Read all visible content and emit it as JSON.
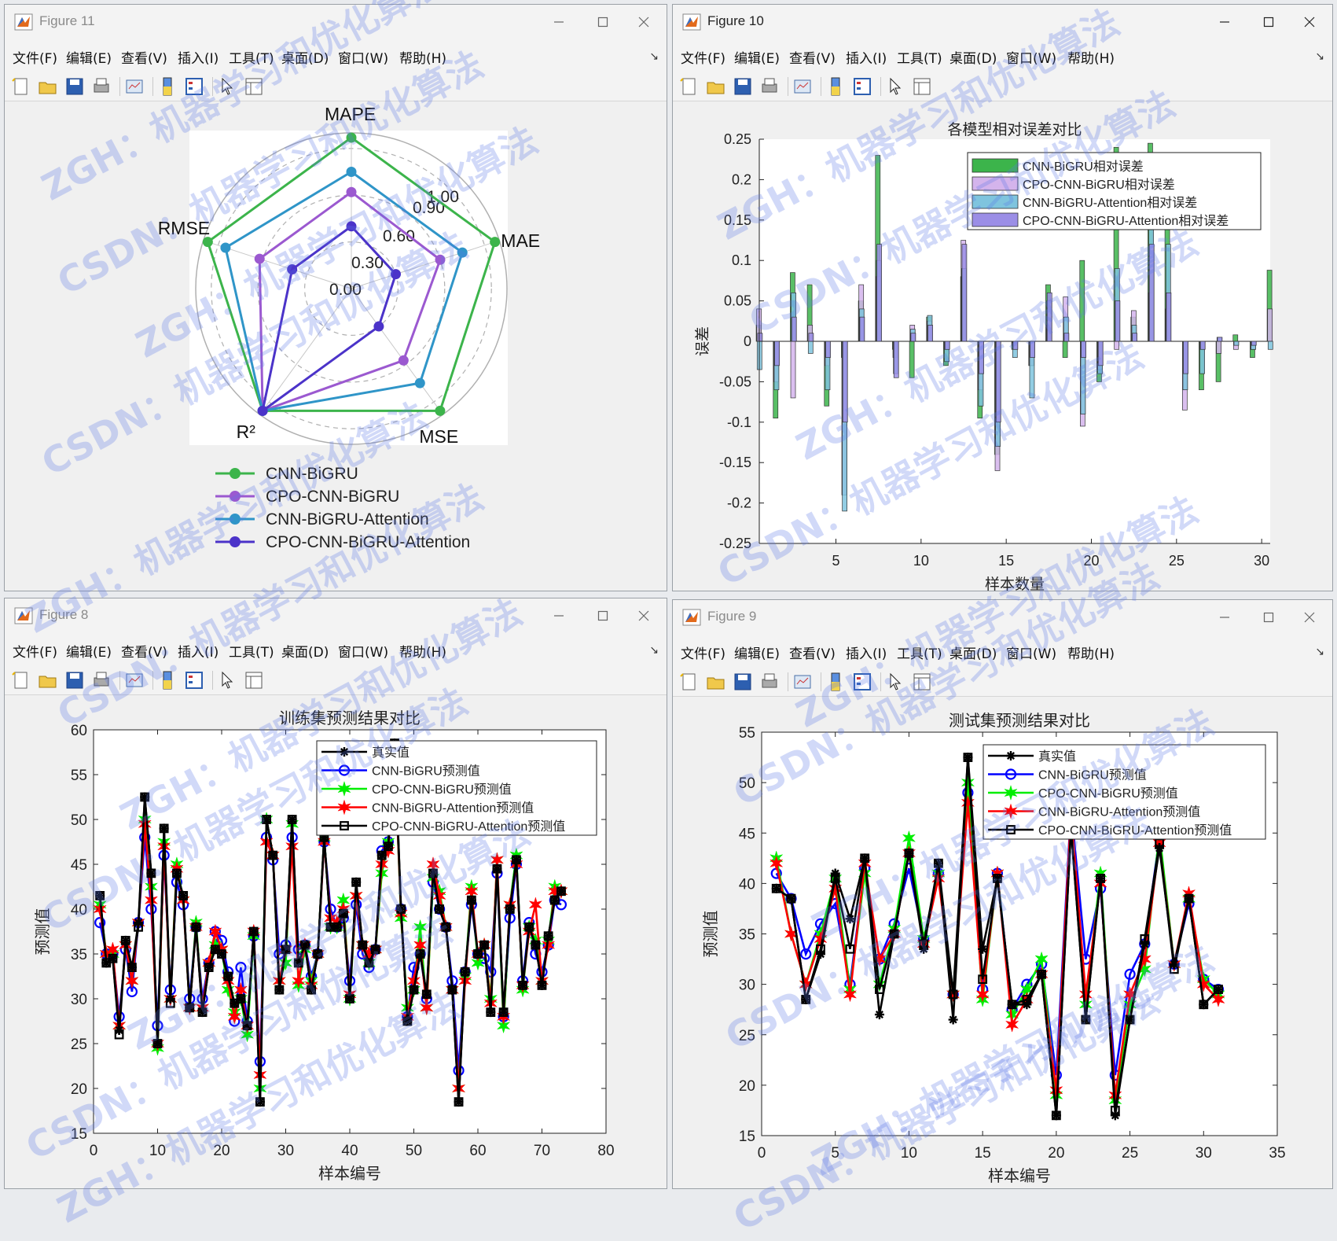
{
  "menu": [
    "文件(F)",
    "编辑(E)",
    "查看(V)",
    "插入(I)",
    "工具(T)",
    "桌面(D)",
    "窗口(W)",
    "帮助(H)"
  ],
  "windows": {
    "fig11": {
      "title": "Figure 11",
      "active": false
    },
    "fig10": {
      "title": "Figure 10",
      "active": true
    },
    "fig8": {
      "title": "Figure 8",
      "active": false
    },
    "fig9": {
      "title": "Figure 9",
      "active": false
    }
  },
  "watermark": [
    "ZGH：机器学习和优化算法",
    "CSDN：机器学习和优化算法"
  ],
  "colors": {
    "green": "#3cb44b",
    "purple": "#9b59d0",
    "blue": "#2f95c8",
    "indigo": "#4b33c9"
  },
  "chart_data": [
    {
      "type": "radar",
      "window": "fig11",
      "axes": [
        "MAPE",
        "MAE",
        "MSE",
        "R²",
        "RMSE"
      ],
      "rings": [
        0.0,
        0.3,
        0.6,
        0.9,
        1.0
      ],
      "ring_labels": [
        "0.00",
        "0.30",
        "0.60",
        "0.90",
        "1.00"
      ],
      "series": [
        {
          "name": "CNN-BiGRU",
          "color": "#3cb44b",
          "values": [
            0.97,
            0.97,
            0.97,
            0.97,
            0.97
          ]
        },
        {
          "name": "CPO-CNN-BiGRU",
          "color": "#9b59d0",
          "values": [
            0.62,
            0.6,
            0.57,
            0.97,
            0.62
          ]
        },
        {
          "name": "CNN-BiGRU-Attention",
          "color": "#2f95c8",
          "values": [
            0.75,
            0.75,
            0.75,
            0.97,
            0.85
          ]
        },
        {
          "name": "CPO-CNN-BiGRU-Attention",
          "color": "#4b33c9",
          "values": [
            0.4,
            0.3,
            0.3,
            0.97,
            0.4
          ]
        }
      ]
    },
    {
      "type": "bar",
      "window": "fig10",
      "title": "各模型相对误差对比",
      "xlabel": "样本数量",
      "ylabel": "误差",
      "xlim": [
        0.5,
        30.5
      ],
      "ylim": [
        -0.25,
        0.25
      ],
      "xticks": [
        5,
        10,
        15,
        20,
        25,
        30
      ],
      "yticks": [
        -0.25,
        -0.2,
        -0.15,
        -0.1,
        -0.05,
        0,
        0.05,
        0.1,
        0.15,
        0.2,
        0.25
      ],
      "ytick_labels": [
        "-0.25",
        "-0.2",
        "-0.15",
        "-0.1",
        "-0.05",
        "0",
        "0.05",
        "0.1",
        "0.15",
        "0.2",
        "0.25"
      ],
      "legend": "top-right",
      "series": [
        {
          "name": "CNN-BiGRU相对误差",
          "color": "#3cb44b",
          "values": [
            0.02,
            -0.095,
            0.085,
            0.07,
            -0.08,
            -0.02,
            0.05,
            0.23,
            -0.01,
            -0.045,
            0.03,
            -0.03,
            0.08,
            -0.095,
            -0.14,
            -0.01,
            -0.03,
            0.07,
            -0.02,
            0.1,
            -0.05,
            0.24,
            0.03,
            0.245,
            0.19,
            0.0,
            -0.06,
            -0.05,
            0.008,
            -0.02,
            0.088
          ]
        },
        {
          "name": "CPO-CNN-BiGRU相对误差",
          "color": "#d4b4ec",
          "values": [
            0.04,
            -0.05,
            -0.07,
            0.02,
            -0.03,
            -0.19,
            0.07,
            0.08,
            -0.02,
            0.02,
            0.025,
            -0.01,
            0.125,
            -0.06,
            -0.16,
            -0.005,
            -0.03,
            0.02,
            0.055,
            -0.105,
            -0.035,
            -0.01,
            0.038,
            0.06,
            0.04,
            -0.085,
            -0.01,
            -0.015,
            -0.01,
            -0.01,
            0.04
          ]
        },
        {
          "name": "CNN-BiGRU-Attention相对误差",
          "color": "#7fc4de",
          "values": [
            -0.035,
            -0.06,
            0.06,
            -0.015,
            -0.06,
            -0.21,
            0.04,
            0.1,
            -0.04,
            0.015,
            0.032,
            -0.025,
            0.09,
            -0.08,
            -0.13,
            -0.02,
            -0.07,
            0.05,
            0.03,
            -0.09,
            -0.04,
            0.09,
            0.02,
            0.18,
            0.12,
            -0.06,
            -0.04,
            0.005,
            -0.005,
            -0.01,
            -0.01
          ]
        },
        {
          "name": "CPO-CNN-BiGRU-Attention相对误差",
          "color": "#9b8ee6",
          "values": [
            0.01,
            -0.03,
            0.03,
            0.01,
            -0.02,
            -0.1,
            0.03,
            0.12,
            -0.045,
            0.01,
            0.02,
            -0.01,
            0.12,
            -0.04,
            -0.1,
            -0.01,
            -0.02,
            0.06,
            0.01,
            -0.02,
            -0.03,
            0.05,
            0.01,
            0.12,
            0.06,
            -0.04,
            -0.01,
            0.005,
            0.0,
            -0.005,
            0.0
          ]
        }
      ]
    },
    {
      "type": "line",
      "window": "fig8",
      "title": "训练集预测结果对比",
      "xlabel": "样本编号",
      "ylabel": "预测值",
      "xlim": [
        0,
        80
      ],
      "ylim": [
        15,
        60
      ],
      "xticks": [
        0,
        10,
        20,
        30,
        40,
        50,
        60,
        70,
        80
      ],
      "yticks": [
        15,
        20,
        25,
        30,
        35,
        40,
        45,
        50,
        55,
        60
      ],
      "legend": "top-right",
      "series": [
        {
          "name": "真实值",
          "color": "#000000",
          "marker": "star",
          "values": [
            41.5,
            34.0,
            34.5,
            26.5,
            36.5,
            33.5,
            38.5,
            52.5,
            44.0,
            25.0,
            49.0,
            30.0,
            44.0,
            41.5,
            29.0,
            38.0,
            28.5,
            33.5,
            35.5,
            35.0,
            32.5,
            29.5,
            30.0,
            27.0,
            37.5,
            18.5,
            50.0,
            46.0,
            31.0,
            35.5,
            50.0,
            34.0,
            36.0,
            31.0,
            35.0,
            48.0,
            38.0,
            38.0,
            39.5,
            30.0,
            43.0,
            36.0,
            34.0,
            35.5,
            46.0,
            47.0,
            58.5,
            40.0,
            27.5,
            31.0,
            35.0,
            30.5,
            44.0,
            40.0,
            38.0,
            31.0,
            18.5,
            33.0,
            41.0,
            35.0,
            36.0,
            28.5,
            44.5,
            28.5,
            40.0,
            45.5,
            31.5,
            38.0,
            36.0,
            31.5,
            37.0,
            41.0,
            42.0
          ]
        },
        {
          "name": "CNN-BiGRU预测值",
          "color": "#0000ff",
          "marker": "circle",
          "values": [
            38.5,
            35.0,
            35.0,
            28.0,
            35.5,
            30.8,
            38.5,
            48.0,
            40.0,
            27.0,
            46.0,
            31.0,
            43.0,
            40.5,
            30.0,
            38.0,
            30.0,
            34.0,
            37.5,
            36.5,
            33.0,
            27.5,
            33.5,
            27.5,
            37.0,
            23.0,
            48.0,
            45.5,
            35.0,
            36.0,
            48.0,
            35.5,
            36.0,
            32.5,
            35.0,
            47.5,
            40.0,
            38.0,
            39.0,
            32.0,
            40.5,
            35.0,
            33.5,
            35.5,
            46.5,
            47.5,
            57.0,
            40.0,
            28.0,
            33.5,
            35.0,
            30.0,
            43.0,
            40.0,
            38.0,
            32.0,
            22.0,
            33.0,
            40.5,
            35.0,
            34.5,
            33.0,
            44.0,
            28.0,
            39.0,
            45.0,
            32.0,
            38.5,
            35.0,
            33.0,
            36.0,
            41.0,
            40.5
          ]
        },
        {
          "name": "CPO-CNN-BiGRU预测值",
          "color": "#00ee00",
          "marker": "star6",
          "values": [
            40.5,
            35.0,
            35.0,
            27.0,
            36.0,
            32.0,
            38.5,
            50.0,
            42.5,
            24.5,
            47.5,
            30.0,
            45.0,
            41.0,
            29.0,
            38.5,
            29.0,
            34.0,
            36.0,
            35.5,
            31.0,
            28.5,
            30.0,
            26.0,
            37.0,
            20.0,
            50.0,
            46.0,
            32.0,
            34.0,
            49.5,
            31.5,
            35.5,
            32.0,
            35.0,
            48.0,
            38.0,
            38.0,
            41.0,
            30.0,
            41.5,
            36.0,
            34.0,
            35.5,
            44.0,
            47.5,
            58.0,
            39.0,
            29.0,
            31.0,
            38.0,
            29.0,
            43.5,
            42.0,
            38.0,
            31.0,
            20.0,
            32.5,
            42.5,
            34.0,
            36.0,
            30.0,
            45.5,
            27.0,
            40.5,
            46.0,
            31.0,
            38.0,
            36.5,
            32.0,
            36.5,
            42.5,
            42.0
          ]
        },
        {
          "name": "CNN-BiGRU-Attention预测值",
          "color": "#ff0000",
          "marker": "star6",
          "values": [
            40.0,
            35.0,
            35.5,
            27.0,
            36.0,
            32.0,
            38.5,
            49.5,
            41.0,
            25.0,
            47.0,
            30.0,
            44.5,
            41.0,
            29.0,
            38.0,
            29.0,
            34.0,
            37.5,
            35.5,
            32.0,
            28.0,
            31.0,
            27.0,
            37.5,
            21.5,
            47.5,
            46.0,
            32.0,
            35.5,
            47.0,
            32.0,
            36.0,
            31.5,
            35.0,
            47.5,
            39.0,
            38.5,
            40.0,
            30.5,
            41.5,
            36.0,
            35.0,
            35.5,
            45.0,
            46.5,
            57.5,
            39.5,
            28.0,
            32.0,
            36.0,
            29.0,
            45.0,
            41.5,
            38.0,
            31.0,
            20.0,
            32.0,
            42.0,
            35.0,
            36.0,
            29.5,
            45.5,
            28.0,
            40.5,
            45.0,
            31.5,
            37.5,
            40.5,
            32.0,
            36.0,
            42.0,
            42.0
          ]
        },
        {
          "name": "CPO-CNN-BiGRU-Attention预测值",
          "color": "#000000",
          "marker": "square",
          "values": [
            41.5,
            34.0,
            34.5,
            26.0,
            36.5,
            33.5,
            38.0,
            52.5,
            44.0,
            25.0,
            49.0,
            29.5,
            44.0,
            41.5,
            29.0,
            38.0,
            28.5,
            33.5,
            35.5,
            35.0,
            32.5,
            29.5,
            30.0,
            27.0,
            37.5,
            18.5,
            50.0,
            46.0,
            31.0,
            35.5,
            50.0,
            34.0,
            36.0,
            31.0,
            35.0,
            48.0,
            38.0,
            38.0,
            39.5,
            30.0,
            43.0,
            36.0,
            34.0,
            35.5,
            46.0,
            47.0,
            58.5,
            40.0,
            27.5,
            31.0,
            35.0,
            30.5,
            44.0,
            40.0,
            38.0,
            31.0,
            18.5,
            33.0,
            41.0,
            35.0,
            36.0,
            28.5,
            44.5,
            28.5,
            40.0,
            45.5,
            31.5,
            38.0,
            36.0,
            31.5,
            37.0,
            41.0,
            42.0
          ]
        }
      ]
    },
    {
      "type": "line",
      "window": "fig9",
      "title": "测试集预测结果对比",
      "xlabel": "样本编号",
      "ylabel": "预测值",
      "xlim": [
        0,
        35
      ],
      "ylim": [
        15,
        55
      ],
      "xticks": [
        0,
        5,
        10,
        15,
        20,
        25,
        30,
        35
      ],
      "yticks": [
        15,
        20,
        25,
        30,
        35,
        40,
        45,
        50,
        55
      ],
      "legend": "top-right",
      "series": [
        {
          "name": "真实值",
          "color": "#000000",
          "marker": "star",
          "values": [
            39.5,
            38.5,
            28.5,
            33.0,
            41.0,
            36.5,
            42.5,
            27.0,
            35.0,
            43.0,
            33.5,
            42.0,
            26.5,
            52.5,
            33.5,
            40.5,
            28.0,
            28.0,
            31.0,
            17.0,
            45.5,
            26.5,
            40.5,
            17.0,
            26.5,
            34.0,
            43.5,
            32.0,
            38.5,
            28.0,
            29.5
          ]
        },
        {
          "name": "CNN-BiGRU预测值",
          "color": "#0000ff",
          "marker": "circle",
          "values": [
            41.0,
            38.5,
            33.0,
            36.0,
            38.0,
            30.0,
            41.5,
            32.5,
            36.0,
            41.5,
            34.5,
            41.0,
            29.0,
            49.0,
            29.5,
            41.0,
            27.5,
            30.0,
            32.0,
            21.0,
            47.5,
            32.5,
            39.5,
            21.0,
            31.0,
            34.0,
            44.5,
            32.0,
            38.0,
            30.5,
            29.5
          ]
        },
        {
          "name": "CPO-CNN-BiGRU预测值",
          "color": "#00ee00",
          "marker": "star6",
          "values": [
            42.5,
            35.0,
            30.0,
            35.0,
            40.5,
            29.5,
            41.0,
            30.0,
            35.5,
            44.5,
            34.5,
            41.0,
            29.0,
            50.0,
            28.5,
            41.0,
            27.0,
            29.5,
            32.5,
            19.0,
            46.5,
            28.0,
            41.0,
            18.5,
            28.0,
            31.5,
            45.0,
            32.0,
            38.5,
            30.5,
            29.0
          ]
        },
        {
          "name": "CNN-BiGRU-Attention预测值",
          "color": "#ff0000",
          "marker": "star6",
          "values": [
            42.0,
            35.0,
            30.0,
            34.5,
            39.5,
            29.0,
            42.0,
            32.5,
            35.0,
            43.0,
            34.0,
            40.5,
            29.0,
            48.0,
            29.0,
            41.0,
            26.0,
            28.5,
            31.0,
            19.5,
            47.0,
            29.0,
            40.0,
            19.0,
            29.0,
            32.5,
            44.0,
            32.0,
            39.0,
            30.0,
            28.5
          ]
        },
        {
          "name": "CPO-CNN-BiGRU-Attention预测值",
          "color": "#000000",
          "marker": "square",
          "values": [
            39.5,
            38.5,
            28.5,
            33.5,
            40.5,
            33.5,
            42.5,
            29.5,
            35.0,
            43.0,
            34.0,
            42.0,
            29.0,
            52.5,
            30.5,
            40.5,
            28.0,
            28.5,
            31.0,
            17.0,
            45.5,
            26.5,
            40.5,
            17.5,
            26.5,
            34.5,
            44.0,
            31.5,
            38.5,
            28.0,
            29.5
          ]
        }
      ]
    }
  ]
}
